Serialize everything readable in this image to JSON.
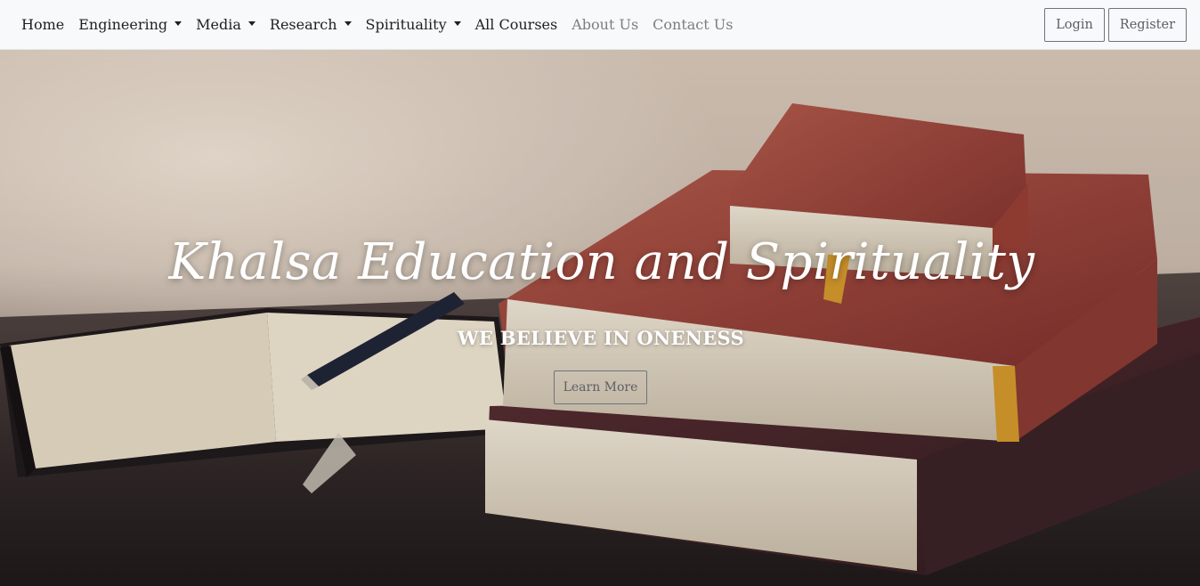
{
  "navbar": {
    "items": [
      {
        "label": "Home",
        "dropdown": false,
        "muted": false
      },
      {
        "label": "Engineering",
        "dropdown": true,
        "muted": false
      },
      {
        "label": "Media",
        "dropdown": true,
        "muted": false
      },
      {
        "label": "Research",
        "dropdown": true,
        "muted": false
      },
      {
        "label": "Spirituality",
        "dropdown": true,
        "muted": false
      },
      {
        "label": "All Courses",
        "dropdown": false,
        "muted": false
      },
      {
        "label": "About Us",
        "dropdown": false,
        "muted": true
      },
      {
        "label": "Contact Us",
        "dropdown": false,
        "muted": true
      }
    ],
    "login_label": "Login",
    "register_label": "Register"
  },
  "hero": {
    "title": "Khalsa Education and Spirituality",
    "subtitle": "WE BELIEVE IN ONENESS",
    "cta_label": "Learn More",
    "background_image": "books-and-pen-icon"
  },
  "colors": {
    "navbar_bg": "#f8f9fa",
    "text_dark": "#1f1f1f",
    "text_muted": "#7d7d7d",
    "button_border": "#6c757d"
  }
}
